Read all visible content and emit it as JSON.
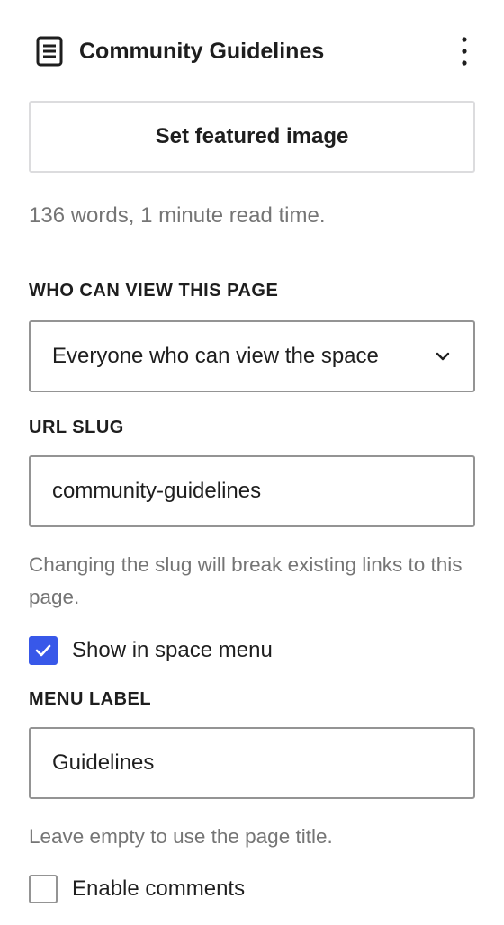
{
  "header": {
    "title": "Community Guidelines",
    "page_icon": "document-icon",
    "menu_icon": "more-vertical-icon"
  },
  "featured_image": {
    "label": "Set featured image"
  },
  "meta": {
    "text": "136 words, 1 minute read time."
  },
  "visibility": {
    "label": "WHO CAN VIEW THIS PAGE",
    "selected": "Everyone who can view the space",
    "icon": "chevron-down-icon"
  },
  "url_slug": {
    "label": "URL SLUG",
    "value": "community-guidelines",
    "help": "Changing the slug will break existing links to this page."
  },
  "space_menu": {
    "label": "Show in space menu",
    "checked": true,
    "icon": "checkmark-icon"
  },
  "menu_label": {
    "label": "MENU LABEL",
    "value": "Guidelines",
    "help": "Leave empty to use the page title."
  },
  "comments": {
    "label": "Enable comments",
    "checked": false
  },
  "colors": {
    "accent": "#3858e9",
    "text": "#1e1e1e",
    "muted": "#757575",
    "border": "#949494"
  }
}
